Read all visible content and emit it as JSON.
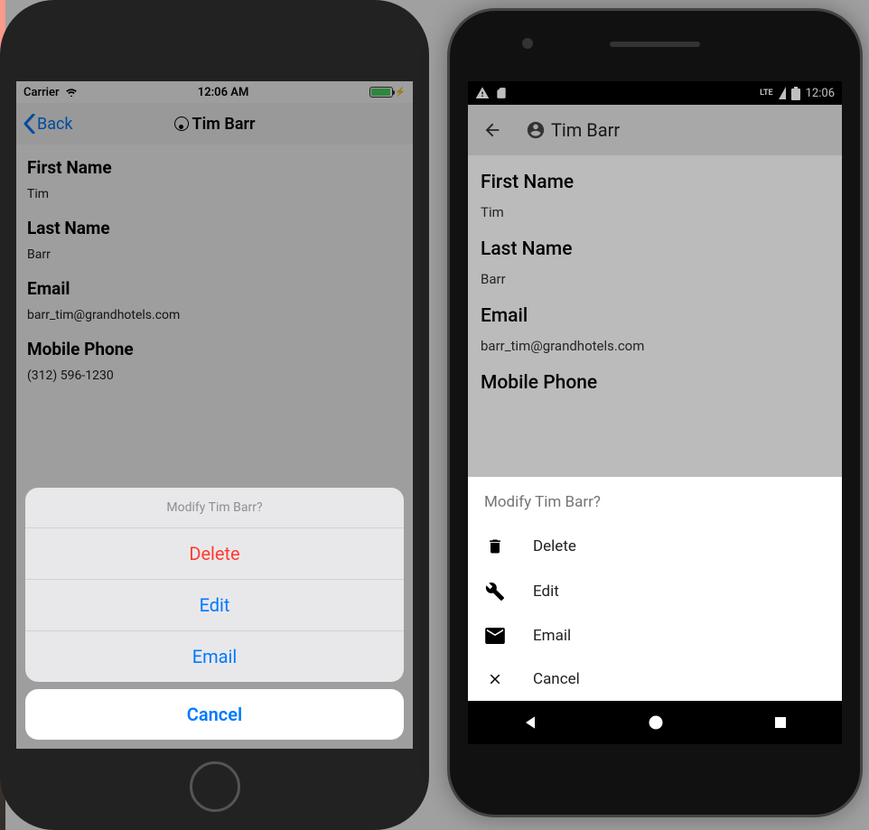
{
  "ios": {
    "status": {
      "carrier": "Carrier",
      "time": "12:06 AM"
    },
    "nav": {
      "back": "Back",
      "title": "Tim Barr"
    },
    "fields": {
      "first_name_label": "First Name",
      "first_name_value": "Tim",
      "last_name_label": "Last Name",
      "last_name_value": "Barr",
      "email_label": "Email",
      "email_value": "barr_tim@grandhotels.com",
      "phone_label": "Mobile Phone",
      "phone_value": "(312) 596-1230"
    },
    "sheet": {
      "title": "Modify Tim Barr?",
      "delete": "Delete",
      "edit": "Edit",
      "email": "Email",
      "cancel": "Cancel"
    }
  },
  "android": {
    "status": {
      "time": "12:06",
      "network": "LTE"
    },
    "toolbar": {
      "title": "Tim Barr"
    },
    "fields": {
      "first_name_label": "First Name",
      "first_name_value": "Tim",
      "last_name_label": "Last Name",
      "last_name_value": "Barr",
      "email_label": "Email",
      "email_value": "barr_tim@grandhotels.com",
      "phone_label": "Mobile Phone"
    },
    "sheet": {
      "title": "Modify Tim Barr?",
      "delete": "Delete",
      "edit": "Edit",
      "email": "Email",
      "cancel": "Cancel"
    }
  }
}
